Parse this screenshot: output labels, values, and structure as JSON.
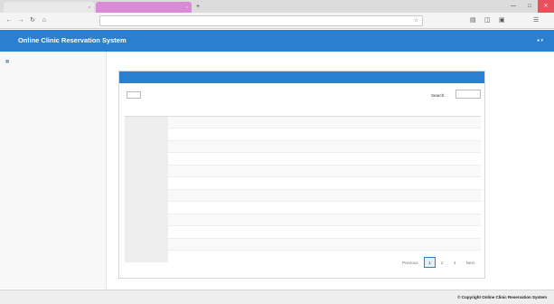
{
  "browser": {
    "tabs": [
      {
        "title": ""
      },
      {
        "title": ""
      }
    ],
    "tab_close_glyph": "×",
    "new_tab_glyph": "+",
    "url": "",
    "icons": [
      "back-icon",
      "forward-icon",
      "reload-icon",
      "home-icon",
      "bookmark-star-icon",
      "library-icon",
      "sidebar-icon",
      "menu-icon"
    ],
    "window_controls": [
      "minimize",
      "maximize",
      "close"
    ]
  },
  "header": {
    "title": "Online Clinic Reservation System",
    "user_label": ""
  },
  "sidebar": {
    "items": [
      {
        "label": ""
      }
    ]
  },
  "panel": {
    "title": "",
    "length_prefix": "",
    "length_value": "",
    "length_suffix": "",
    "search_label": "Search:",
    "columns": [
      "",
      "",
      "",
      "",
      "",
      "",
      ""
    ],
    "rows": [
      [
        "",
        "",
        "",
        "",
        "",
        "",
        ""
      ],
      [
        "",
        "",
        "",
        "",
        "",
        "",
        ""
      ],
      [
        "",
        "",
        "",
        "",
        "",
        "",
        ""
      ],
      [
        "",
        "",
        "",
        "",
        "",
        "",
        ""
      ],
      [
        "",
        "",
        "",
        "",
        "",
        "",
        ""
      ],
      [
        "",
        "",
        "",
        "",
        "",
        "",
        ""
      ],
      [
        "",
        "",
        "",
        "",
        "",
        "",
        ""
      ],
      [
        "",
        "",
        "",
        "",
        "",
        "",
        ""
      ],
      [
        "",
        "",
        "",
        "",
        "",
        "",
        ""
      ],
      [
        "",
        "",
        "",
        "",
        "",
        "",
        ""
      ],
      [
        "",
        "",
        "",
        "",
        "",
        "",
        ""
      ],
      [
        "",
        "",
        "",
        "",
        "",
        "",
        ""
      ]
    ],
    "info": "",
    "pagination": {
      "previous": "Previous",
      "pages": [
        "1",
        "2",
        "3"
      ],
      "active_page": "1",
      "next": "Next"
    }
  },
  "footer": {
    "text": "© Copyright Online Clinic Reservation System"
  },
  "colors": {
    "primary": "#2a7fd0",
    "active_tab": "#d98bd5",
    "close_button": "#e8515c",
    "link": "#337ab7"
  }
}
